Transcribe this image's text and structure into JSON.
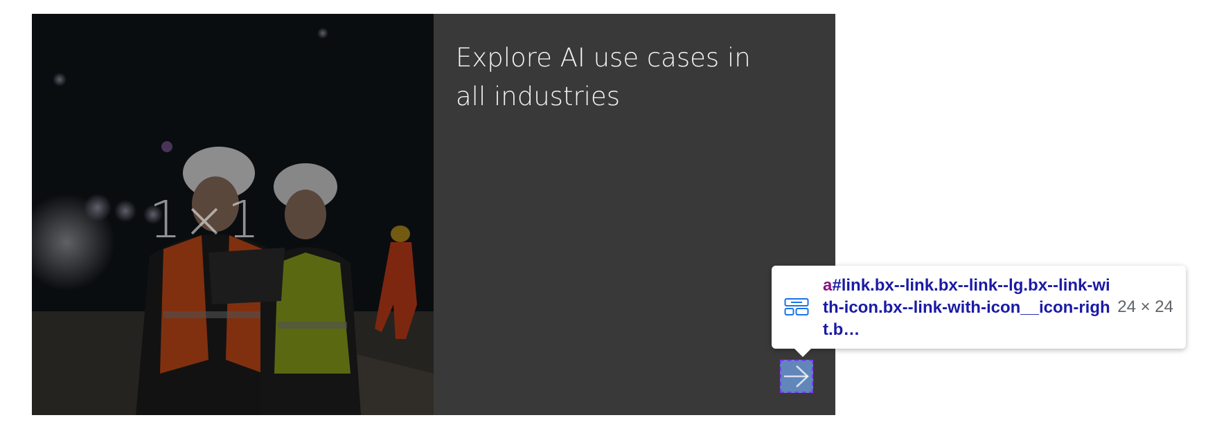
{
  "card": {
    "image_aspect_label": "1×1",
    "heading": "Explore AI use cases in all industries",
    "link_icon": "arrow-right-icon",
    "colors": {
      "body_background": "#393939",
      "heading_text": "#f4f4f4",
      "link_highlight": "#6fa0e6"
    }
  },
  "inspector_tooltip": {
    "element_icon": "layout-icon",
    "tag": "a",
    "selector": "#link.bx--link.bx--link--lg.bx--link-with-icon.bx--link-with-icon__icon-right.b…",
    "size": "24 × 24",
    "colors": {
      "tag": "#881280",
      "selector": "#1a1aa6",
      "size": "#5f6368"
    }
  }
}
